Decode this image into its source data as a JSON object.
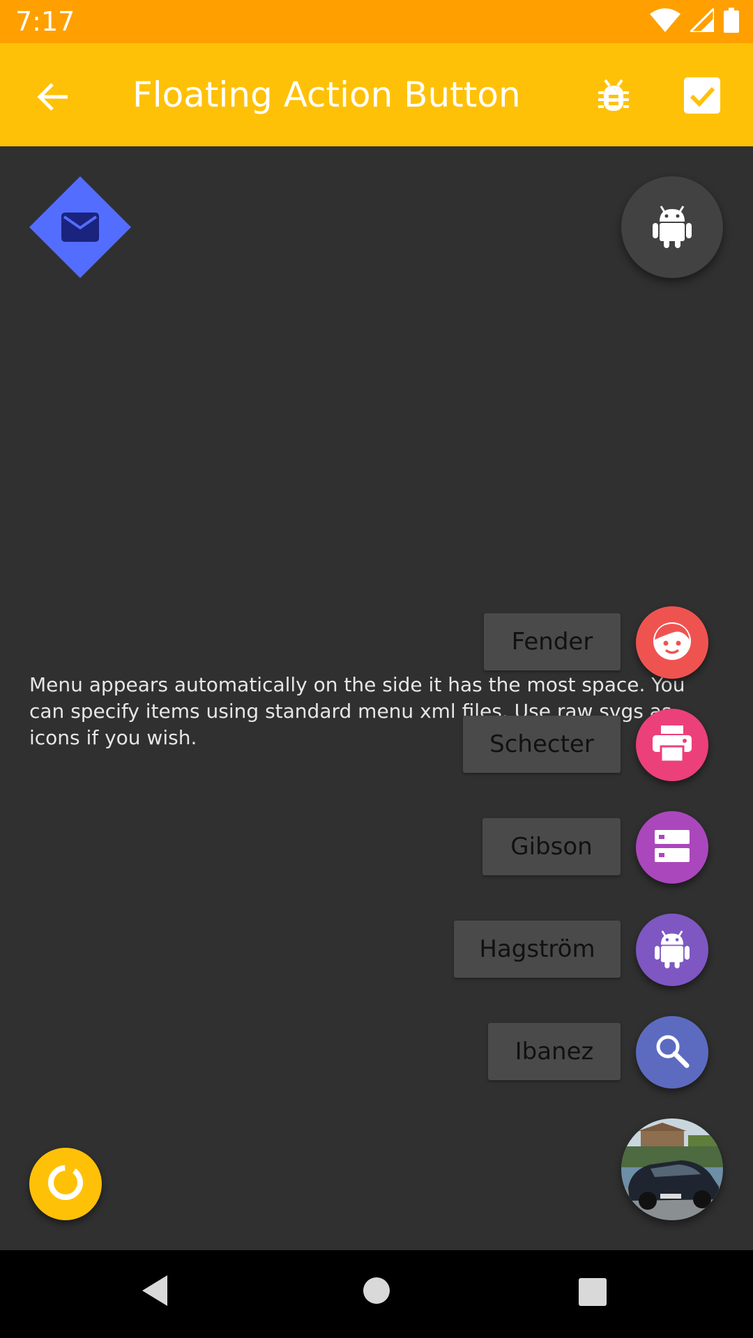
{
  "status_bar": {
    "time": "7:17",
    "icons": [
      "wifi-icon",
      "cell-signal-icon",
      "battery-icon"
    ]
  },
  "app_bar": {
    "title": "Floating Action Button",
    "background": "#FFC107",
    "status_background": "#FFA000",
    "actions": [
      "bug-icon",
      "checkbox-icon"
    ]
  },
  "main": {
    "description": "Menu appears automatically on the side it has the most space. You can specify items using standard menu xml files. Use raw svgs as icons if you wish.",
    "top_left_fab": {
      "icon": "mail-icon",
      "color": "#536DFE",
      "shape": "diamond"
    },
    "top_right_fab": {
      "icon": "android-icon",
      "color": "#424242"
    }
  },
  "speed_dial": {
    "items": [
      {
        "label": "Fender",
        "icon": "face-icon",
        "color": "#EF5350"
      },
      {
        "label": "Schecter",
        "icon": "printer-icon",
        "color": "#EC407A"
      },
      {
        "label": "Gibson",
        "icon": "storage-icon",
        "color": "#AB47BC"
      },
      {
        "label": "Hagström",
        "icon": "android-icon",
        "color": "#7E57C2"
      },
      {
        "label": "Ibanez",
        "icon": "search-icon",
        "color": "#5C6BC0"
      }
    ],
    "main_fab": {
      "icon": "car-photo"
    }
  },
  "bottom_left_fab": {
    "icon": "progress-ring-icon",
    "color": "#FFC107"
  },
  "nav_bar": {
    "buttons": [
      "nav-back-icon",
      "nav-home-icon",
      "nav-recents-icon"
    ]
  }
}
